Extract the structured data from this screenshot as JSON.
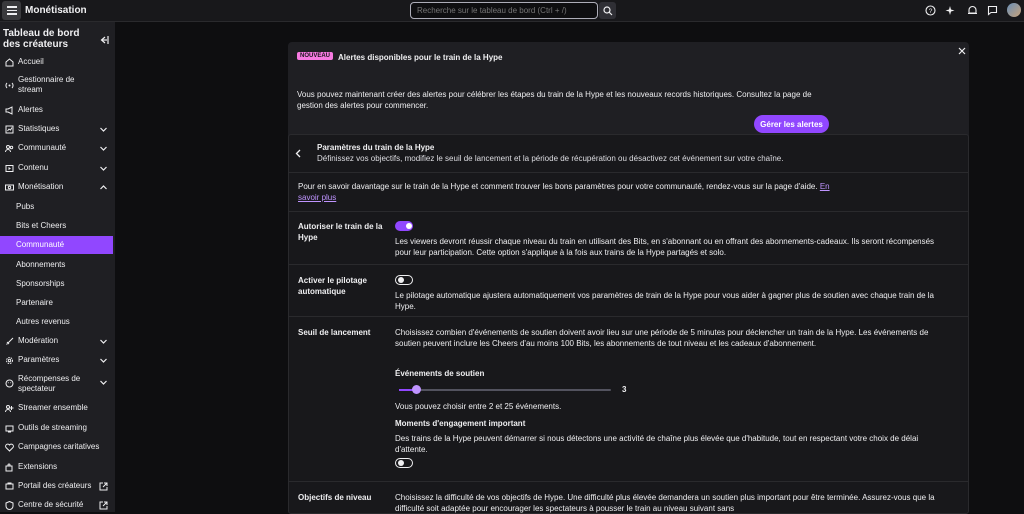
{
  "header": {
    "title": "Monétisation",
    "search_placeholder": "Recherche sur le tableau de bord (Ctrl + /)"
  },
  "sidebar": {
    "title": "Tableau de bord des créateurs",
    "items": [
      {
        "label": "Accueil",
        "icon": "home-icon"
      },
      {
        "label": "Gestionnaire de stream",
        "icon": "broadcast-icon"
      },
      {
        "label": "Alertes",
        "icon": "megaphone-icon"
      },
      {
        "label": "Statistiques",
        "icon": "chart-icon"
      },
      {
        "label": "Communauté",
        "icon": "community-icon"
      },
      {
        "label": "Contenu",
        "icon": "content-icon"
      },
      {
        "label": "Monétisation",
        "icon": "money-icon"
      },
      {
        "label": "Modération",
        "icon": "sword-icon"
      },
      {
        "label": "Paramètres",
        "icon": "gear-icon"
      },
      {
        "label": "Récompenses de spectateur",
        "icon": "reward-icon"
      },
      {
        "label": "Streamer ensemble",
        "icon": "stream-together-icon"
      },
      {
        "label": "Outils de streaming",
        "icon": "tools-icon"
      },
      {
        "label": "Campagnes caritatives",
        "icon": "charity-icon"
      },
      {
        "label": "Extensions",
        "icon": "extensions-icon"
      },
      {
        "label": "Portail des créateurs",
        "icon": "creator-portal-icon"
      },
      {
        "label": "Centre de sécurité",
        "icon": "safety-icon"
      }
    ],
    "sub_items": [
      "Pubs",
      "Bits et Cheers",
      "Communauté",
      "Abonnements",
      "Sponsorships",
      "Partenaire",
      "Autres revenus"
    ],
    "active_sub": "Communauté"
  },
  "banner": {
    "badge": "NOUVEAU",
    "title": "Alertes disponibles pour le train de la Hype",
    "text": "Vous pouvez maintenant créer des alertes pour célébrer les étapes du train de la Hype et les nouveaux records historiques. Consultez la page de gestion des alertes pour commencer.",
    "button": "Gérer les alertes"
  },
  "panel": {
    "title": "Paramètres du train de la Hype",
    "subtitle": "Définissez vos objectifs, modifiez le seuil de lancement et la période de récupération ou désactivez cet événement sur votre chaîne.",
    "info": "Pour en savoir davantage sur le train de la Hype et comment trouver les bons paramètres pour votre communauté, rendez-vous sur la page d'aide.",
    "info_link": "En savoir plus",
    "rows": {
      "authorize": {
        "label": "Autoriser le train de la Hype",
        "enabled": true,
        "desc": "Les viewers devront réussir chaque niveau du train en utilisant des Bits, en s'abonnant ou en offrant des abonnements-cadeaux. Ils seront récompensés pour leur participation. Cette option s'applique à la fois aux trains de la Hype partagés et solo."
      },
      "autopilot": {
        "label": "Activer le pilotage automatique",
        "enabled": false,
        "desc": "Le pilotage automatique ajustera automatiquement vos paramètres de train de la Hype pour vous aider à gagner plus de soutien avec chaque train de la Hype."
      },
      "threshold": {
        "label": "Seuil de lancement",
        "desc": "Choisissez combien d'événements de soutien doivent avoir lieu sur une période de 5 minutes pour déclencher un train de la Hype. Les événements de soutien peuvent inclure les Cheers d'au moins 100 Bits, les abonnements de tout niveau et les cadeaux d'abonnement.",
        "events_title": "Événements de soutien",
        "slider_value": "3",
        "slider_min": 2,
        "slider_max": 25,
        "slider_current": 3,
        "range_text": "Vous pouvez choisir entre 2 et 25 événements.",
        "moments_title": "Moments d'engagement important",
        "moments_desc": "Des trains de la Hype peuvent démarrer si nous détectons une activité de chaîne plus élevée que d'habitude, tout en respectant votre choix de délai d'attente.",
        "moments_enabled": false
      },
      "goals": {
        "label": "Objectifs de niveau",
        "desc": "Choisissez la difficulté de vos objectifs de Hype. Une difficulté plus élevée demandera un soutien plus important pour être terminée. Assurez-vous que la difficulté soit adaptée pour encourager les spectateurs à pousser le train au niveau suivant sans"
      }
    }
  },
  "colors": {
    "accent": "#9147ff",
    "badge": "#f77ae1",
    "bg": "#0e0e10",
    "surface": "#18181b",
    "sidebar": "#1f1f23"
  }
}
